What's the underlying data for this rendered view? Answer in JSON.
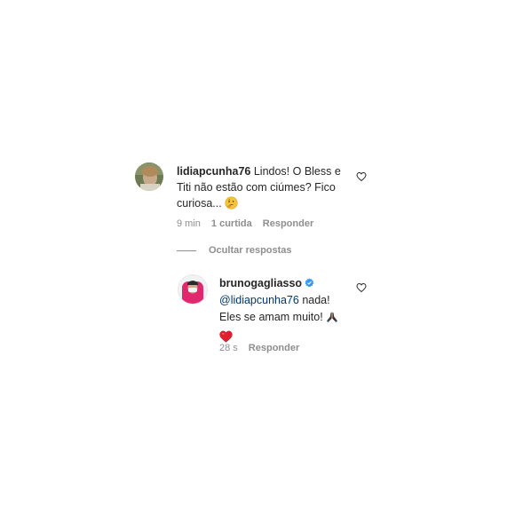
{
  "comment": {
    "username": "lidiapcunha76",
    "text_line1": "Lindos! O Bless e",
    "text_line2": "Titi não estão com ciúmes? Fico",
    "text_line3": "curiosa...",
    "time": "9 min",
    "likes": "1 curtida",
    "reply_label": "Responder",
    "avatar_icon": "user-photo-avatar",
    "emoji_icon": "thinking-face-emoji"
  },
  "replies_toggle": {
    "label": "Ocultar respostas"
  },
  "reply": {
    "username": "brunogagliasso",
    "verified_icon": "verified-badge-icon",
    "mention": "@lidiapcunha76",
    "text_line1_rest": " nada!",
    "text_line2": "Eles se amam muito!",
    "time": "28 s",
    "reply_label": "Responder",
    "avatar_icon": "user-photo-avatar",
    "emojis": [
      "praying-hands-emoji",
      "red-heart-emoji"
    ]
  },
  "colors": {
    "text": "#262626",
    "muted": "#8e8e8e",
    "mention": "#00376b",
    "verified": "#3897f0",
    "heart": "#ed4956"
  }
}
